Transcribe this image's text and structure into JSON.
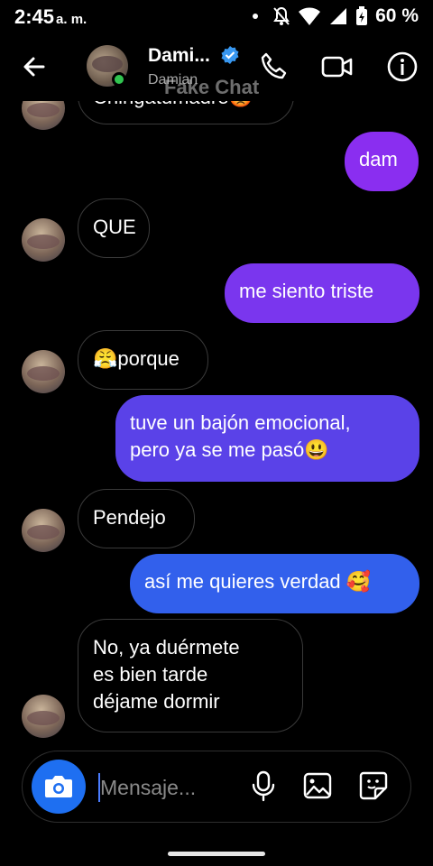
{
  "status_bar": {
    "time": "2:45",
    "ampm": "a. m.",
    "battery": "60 %"
  },
  "header": {
    "name": "Dami...",
    "subtitle": "Damian",
    "watermark": "Fake Chat"
  },
  "messages": [
    {
      "dir": "in",
      "text": "Chingatumadre😡"
    },
    {
      "dir": "out",
      "text": "dam",
      "color": "#8a2ef0"
    },
    {
      "dir": "in",
      "text": "QUE"
    },
    {
      "dir": "out",
      "text": "me siento triste",
      "color": "#7a36ee"
    },
    {
      "dir": "in",
      "text": "😤porque"
    },
    {
      "dir": "out",
      "lines": [
        "tuve un bajón emocional,",
        "pero ya se me pasó😃"
      ],
      "color": "#5a42e8"
    },
    {
      "dir": "in",
      "text": "Pendejo"
    },
    {
      "dir": "out",
      "text": "así me quieres verdad 🥰",
      "color": "#3260ec"
    },
    {
      "dir": "in",
      "lines": [
        "No, ya duérmete",
        "es bien tarde",
        "déjame dormir"
      ]
    }
  ],
  "composer": {
    "placeholder": "Mensaje..."
  },
  "colors": {
    "accent_camera": "#1e6ff1",
    "online": "#31c450",
    "verified": "#3897f0"
  }
}
